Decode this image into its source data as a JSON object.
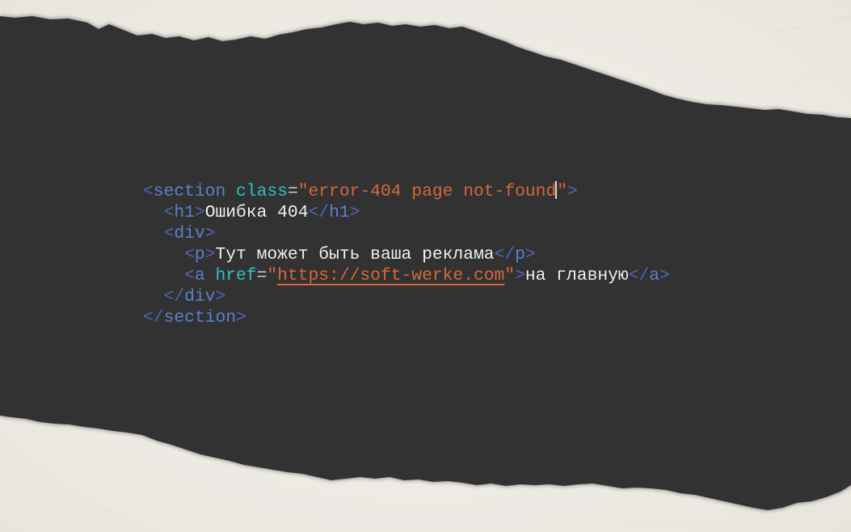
{
  "code": {
    "section_open": {
      "tag": "section",
      "attr_name": "class",
      "attr_value": "error-404 page not-found"
    },
    "h1": {
      "tag": "h1",
      "text": "Ошибка 404"
    },
    "div_tag": "div",
    "p": {
      "tag": "p",
      "text": "Тут может быть ваша реклама"
    },
    "a": {
      "tag": "a",
      "attr_name": "href",
      "url": "https://soft-werke.com",
      "text": "на главную"
    }
  },
  "colors": {
    "background_dark": "#303030",
    "paper": "#f4f2ed",
    "punctuation": "#4f67b0",
    "tag": "#5b80d2",
    "attribute": "#2ec0c8",
    "string": "#d6683a",
    "text": "#f0f0f0"
  }
}
